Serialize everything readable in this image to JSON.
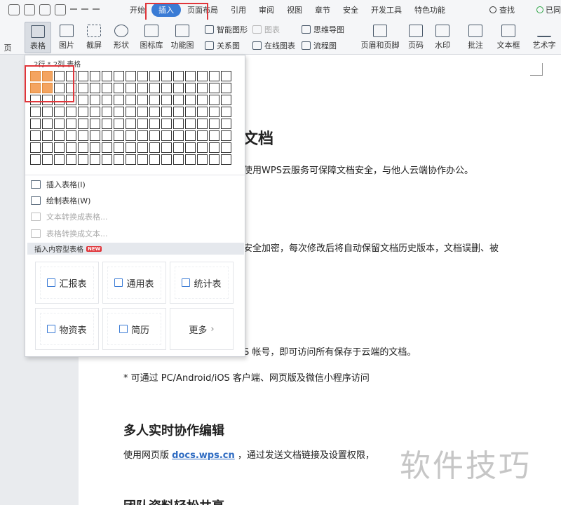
{
  "menu": {
    "tabs": [
      "开始",
      "插入",
      "页面布局",
      "引用",
      "审阅",
      "视图",
      "章节",
      "安全",
      "开发工具",
      "特色功能"
    ],
    "active_tab": "插入",
    "search": "查找",
    "sync": "已同"
  },
  "ribbon": {
    "page": "页",
    "table": "表格",
    "image": "图片",
    "screenshot": "截屏",
    "shape": "形状",
    "icon_lib": "图标库",
    "func_chart": "功能图",
    "smart_shape": "智能图形",
    "chart": "图表",
    "mind_map": "思维导图",
    "relation": "关系图",
    "online_chart": "在线图表",
    "flowchart": "流程图",
    "header_footer": "页眉和页脚",
    "page_num": "页码",
    "watermark": "水印",
    "comment": "批注",
    "textbox": "文本框",
    "art_text": "艺术字"
  },
  "table_dropdown": {
    "grid_label": "2行 * 2列 表格",
    "rows": 8,
    "cols": 17,
    "selected_rows": 2,
    "selected_cols": 2,
    "items": [
      {
        "label": "插入表格(I)",
        "enabled": true
      },
      {
        "label": "绘制表格(W)",
        "enabled": true
      },
      {
        "label": "文本转换成表格...",
        "enabled": false
      },
      {
        "label": "表格转换成文本...",
        "enabled": false
      }
    ],
    "section_title": "插入内容型表格",
    "new_badge": "NEW",
    "cards": [
      "汇报表",
      "通用表",
      "统计表",
      "物资表",
      "简历",
      "更多"
    ],
    "more_arrow": "›"
  },
  "document": {
    "title_partial": "文档",
    "line1": "使用WPS云服务可保障文档安全，与他人云端协作办公。",
    "line2": "安全加密，每次修改后将自动保留文档历史版本，文档误删、被",
    "line3": "S 帐号，即可访问所有保存于云端的文档。",
    "bullet": "*  可通过  PC/Android/iOS 客户端、网页版及微信小程序访问",
    "heading2": "多人实时协作编辑",
    "para_prefix": "使用网页版  ",
    "para_link": "docs.wps.cn",
    "para_suffix": "  ，通过发送文档链接及设置权限，",
    "heading3_partial": "团队资料轻松共享"
  },
  "watermark_text": "软件技巧",
  "colors": {
    "accent": "#3a7bd5",
    "highlight_cell": "#f4a460",
    "callout_red": "#e0353a",
    "link": "#2f6cc2"
  }
}
